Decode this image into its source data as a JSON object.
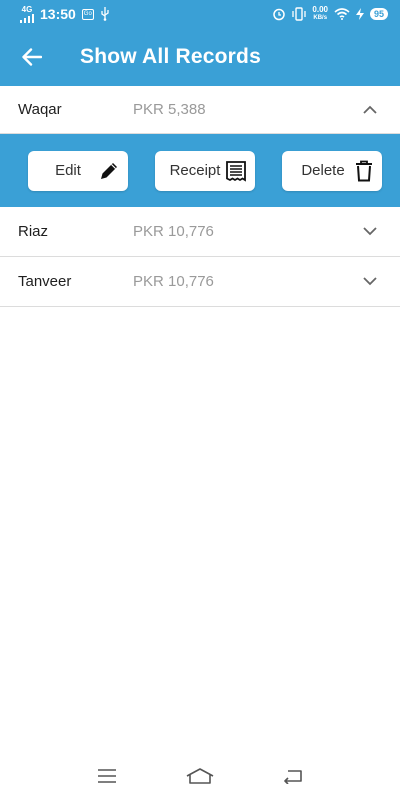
{
  "status_bar": {
    "signal_label": "4G",
    "time": "13:50",
    "badge": "Go",
    "data_rate_top": "0.00",
    "data_rate_bottom": "KB/s",
    "battery": "95"
  },
  "app_bar": {
    "title": "Show All Records",
    "back_icon": "arrow-left-icon"
  },
  "records": [
    {
      "name": "Waqar",
      "amount": "PKR 5,388",
      "expanded": true
    },
    {
      "name": "Riaz",
      "amount": "PKR 10,776",
      "expanded": false
    },
    {
      "name": "Tanveer",
      "amount": "PKR 10,776",
      "expanded": false
    }
  ],
  "actions": {
    "edit_label": "Edit",
    "receipt_label": "Receipt",
    "delete_label": "Delete"
  },
  "colors": {
    "primary": "#3aa0d6",
    "amount_text": "#9a9a9a"
  }
}
